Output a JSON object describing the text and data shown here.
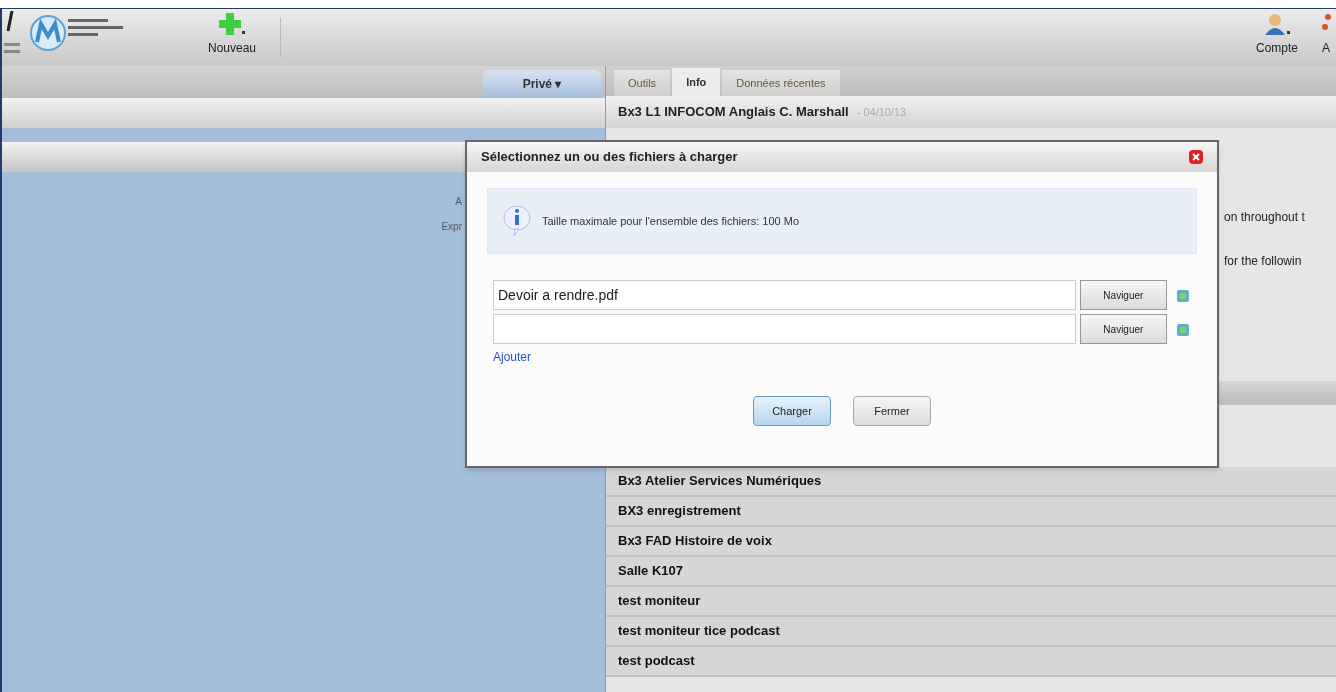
{
  "header": {
    "new_button": "Nouveau",
    "account_button": "Compte",
    "cut_button": "A"
  },
  "left_panel": {
    "menu": "Privé ▾",
    "fragments": [
      "A",
      "Expr"
    ]
  },
  "tabs": [
    {
      "label": "Outils",
      "selected": false
    },
    {
      "label": "Info",
      "selected": true
    },
    {
      "label": "Données récentes",
      "selected": false
    }
  ],
  "course": {
    "title": "Bx3 L1 INFOCOM Anglais C. Marshall",
    "date": "- 04/10/13",
    "lines": [
      "on throughout t",
      "for the followin"
    ]
  },
  "courses": [
    "Bx3 Atelier Services Numériques",
    "BX3 enregistrement",
    "Bx3 FAD Histoire de voix",
    "Salle K107",
    "test moniteur",
    "test moniteur tice podcast",
    "test podcast"
  ],
  "dialog": {
    "title": "Sélectionnez un ou des fichiers à charger",
    "info": "Taille maximale pour l'ensemble des fichiers: 100 Mo",
    "files": [
      {
        "value": "Devoir a rendre.pdf",
        "browse": "Naviguer"
      },
      {
        "browse": "Naviguer"
      }
    ],
    "add_link": "Ajouter",
    "buttons": [
      {
        "label": "Charger",
        "selected": true
      },
      {
        "label": "Fermer",
        "selected": false
      }
    ]
  }
}
